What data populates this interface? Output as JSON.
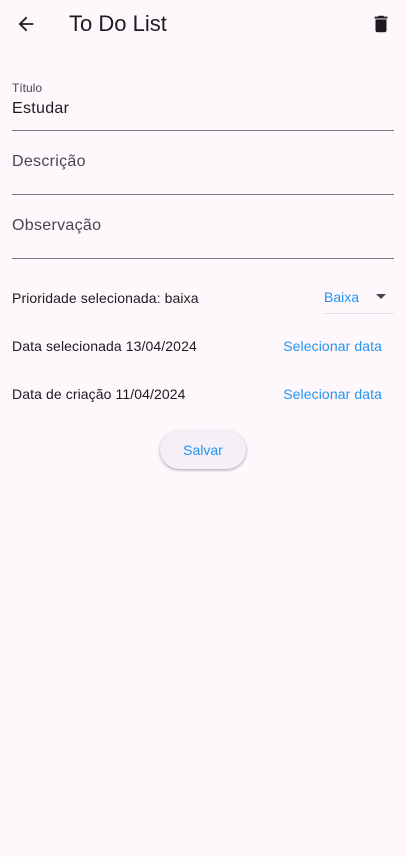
{
  "appbar": {
    "title": "To Do List",
    "back_icon": "arrow-back-icon",
    "delete_icon": "trash-icon"
  },
  "form": {
    "titulo": {
      "label": "Título",
      "value": "Estudar"
    },
    "descricao": {
      "label": "Descrição",
      "value": ""
    },
    "observacao": {
      "label": "Observação",
      "value": ""
    },
    "prioridade": {
      "label": "Prioridade selecionada: baixa",
      "selected": "Baixa"
    },
    "data_selecionada": {
      "label": "Data selecionada 13/04/2024",
      "button": "Selecionar data"
    },
    "data_criacao": {
      "label": "Data de criação 11/04/2024",
      "button": "Selecionar data"
    },
    "save_label": "Salvar"
  },
  "colors": {
    "background": "#fef7fb",
    "accent": "#2196f3",
    "text": "#1d1b20",
    "underline": "#79747e"
  }
}
